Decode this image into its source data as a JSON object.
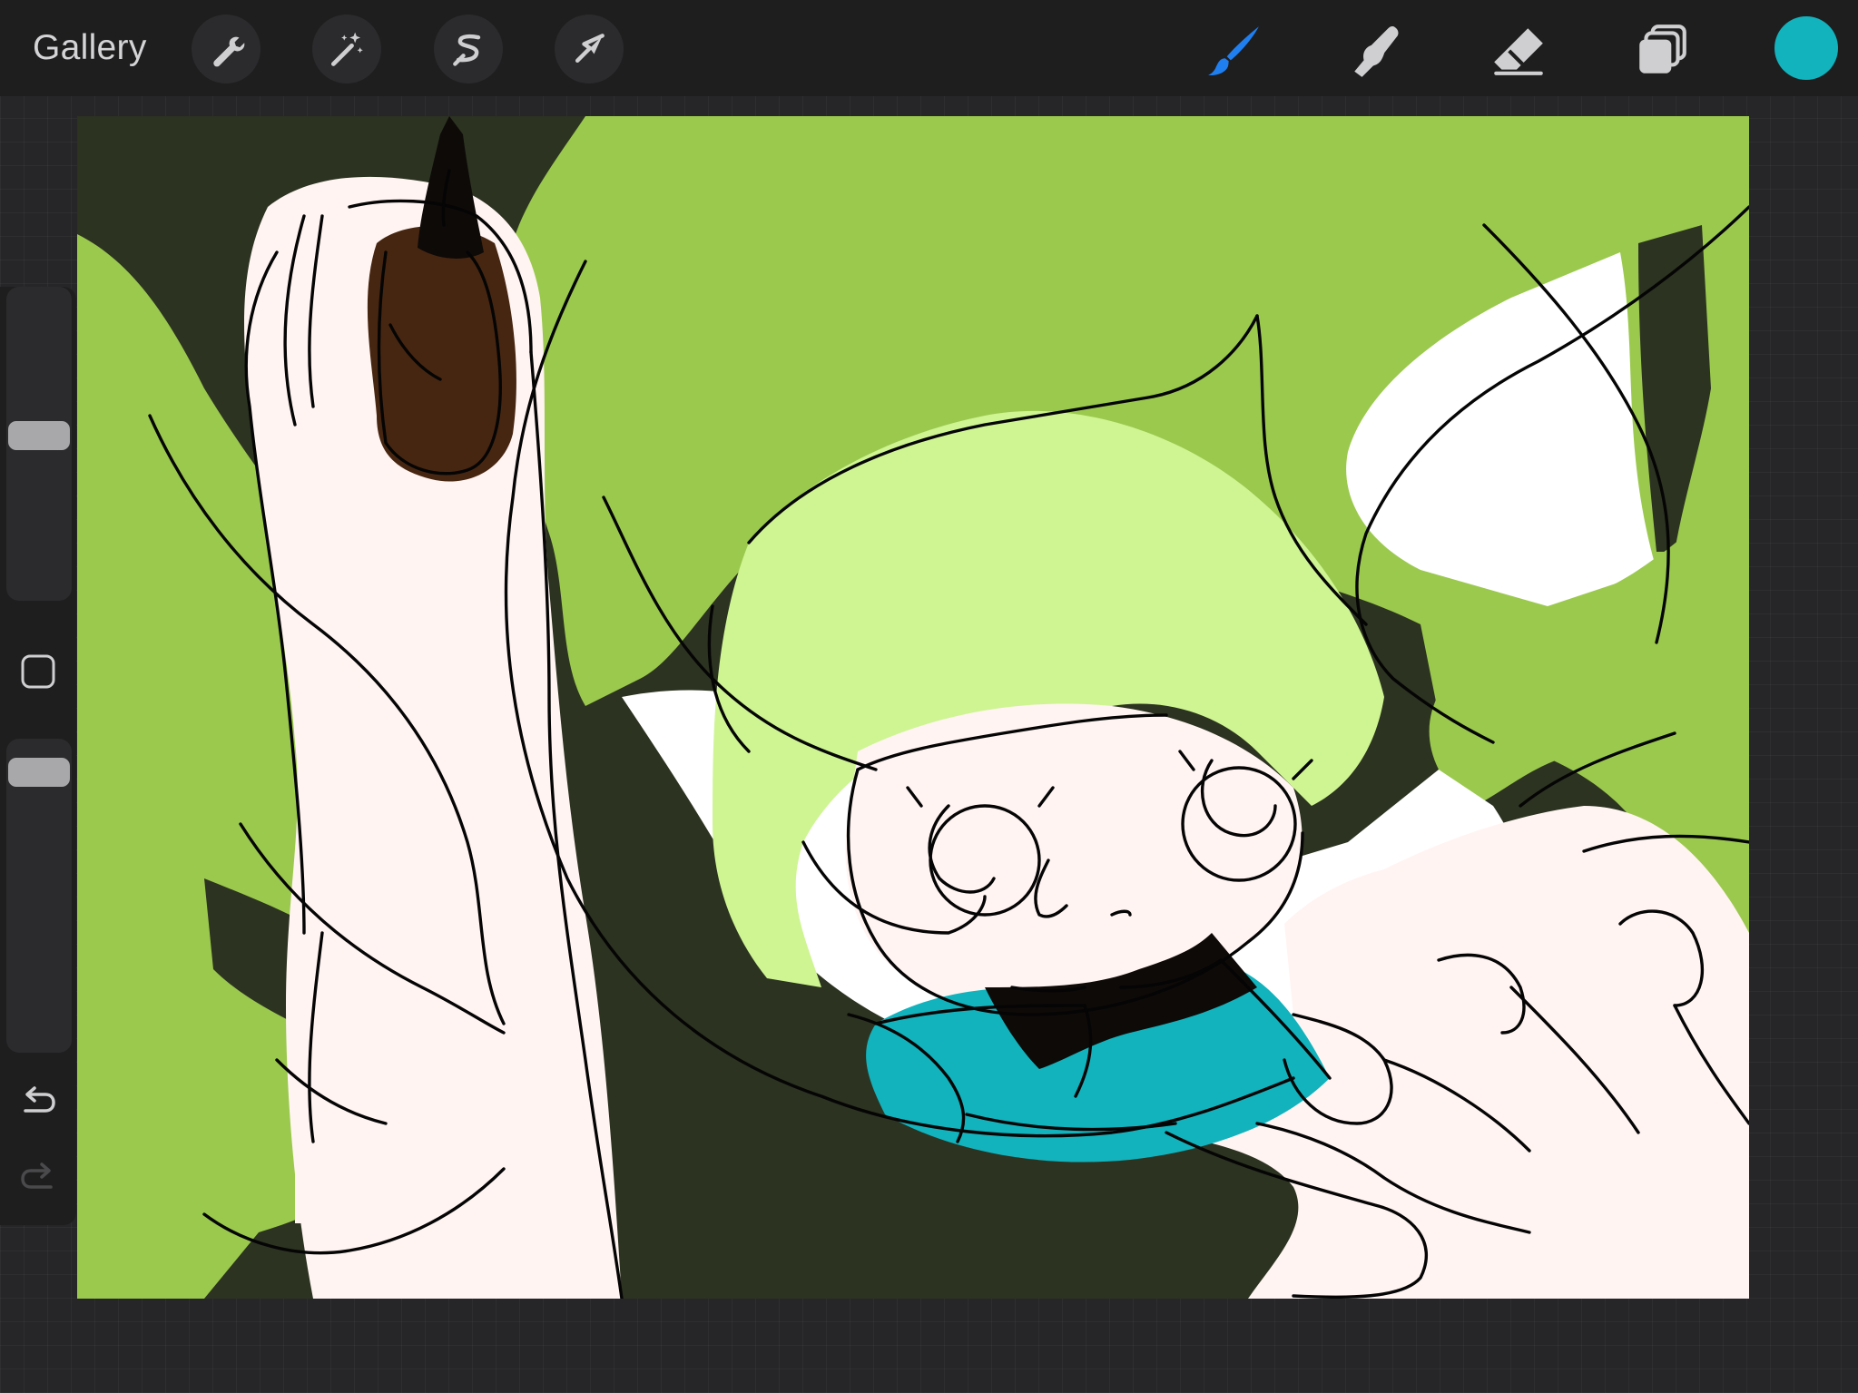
{
  "toolbar": {
    "gallery_label": "Gallery",
    "left_tools": [
      {
        "id": "actions",
        "icon": "wrench-icon"
      },
      {
        "id": "adjustments",
        "icon": "magic-wand-icon"
      },
      {
        "id": "selection",
        "icon": "selection-s-icon"
      },
      {
        "id": "transform",
        "icon": "arrow-cursor-icon"
      }
    ],
    "right_tools": [
      {
        "id": "brush",
        "icon": "brush-icon",
        "active": true
      },
      {
        "id": "smudge",
        "icon": "smudge-finger-icon",
        "active": false
      },
      {
        "id": "eraser",
        "icon": "eraser-icon",
        "active": false
      },
      {
        "id": "layers",
        "icon": "layers-icon",
        "active": false
      }
    ],
    "active_tool_color": "#1f7ff0",
    "current_color": "#12b3bd"
  },
  "sidebar": {
    "brush_size": 0.53,
    "brush_opacity": 0.95,
    "modify_icon": "square-outline-icon",
    "undo_icon": "undo-arrow-icon",
    "redo_icon": "redo-arrow-icon"
  },
  "canvas": {
    "palette": {
      "hair_green": "#9bc94e",
      "light_green": "#cff593",
      "dark_green": "#2c3321",
      "skin": "#fff4f2",
      "white": "#ffffff",
      "teal": "#12b3bd",
      "brown": "#472611",
      "black": "#0e0a08"
    }
  }
}
